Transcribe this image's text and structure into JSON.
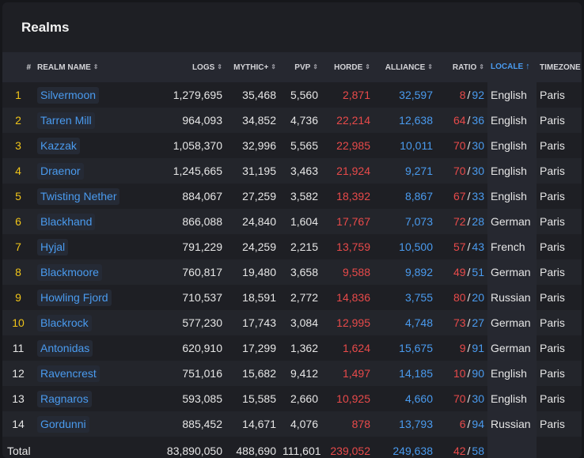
{
  "title": "Realms",
  "headers": {
    "rank": "#",
    "realm": "REALM NAME",
    "logs": "LOGS",
    "mythic": "MYTHIC+",
    "pvp": "PVP",
    "horde": "HORDE",
    "alliance": "ALLIANCE",
    "ratio": "RATIO",
    "locale": "LOCALE",
    "timezone": "TIMEZONE"
  },
  "colors": {
    "gold_rank": "#f0c419",
    "horde": "#e84a4a",
    "alliance": "#4a9bef",
    "active_sort": "#4a9bef"
  },
  "rows": [
    {
      "rank": "1",
      "name": "Silvermoon",
      "logs": "1,279,695",
      "mythic": "35,468",
      "pvp": "5,560",
      "horde": "2,871",
      "alliance": "32,597",
      "ratio_h": "8",
      "ratio_a": "92",
      "locale": "English",
      "timezone": "Paris",
      "gold": true
    },
    {
      "rank": "2",
      "name": "Tarren Mill",
      "logs": "964,093",
      "mythic": "34,852",
      "pvp": "4,736",
      "horde": "22,214",
      "alliance": "12,638",
      "ratio_h": "64",
      "ratio_a": "36",
      "locale": "English",
      "timezone": "Paris",
      "gold": true
    },
    {
      "rank": "3",
      "name": "Kazzak",
      "logs": "1,058,370",
      "mythic": "32,996",
      "pvp": "5,565",
      "horde": "22,985",
      "alliance": "10,011",
      "ratio_h": "70",
      "ratio_a": "30",
      "locale": "English",
      "timezone": "Paris",
      "gold": true
    },
    {
      "rank": "4",
      "name": "Draenor",
      "logs": "1,245,665",
      "mythic": "31,195",
      "pvp": "3,463",
      "horde": "21,924",
      "alliance": "9,271",
      "ratio_h": "70",
      "ratio_a": "30",
      "locale": "English",
      "timezone": "Paris",
      "gold": true
    },
    {
      "rank": "5",
      "name": "Twisting Nether",
      "logs": "884,067",
      "mythic": "27,259",
      "pvp": "3,582",
      "horde": "18,392",
      "alliance": "8,867",
      "ratio_h": "67",
      "ratio_a": "33",
      "locale": "English",
      "timezone": "Paris",
      "gold": true
    },
    {
      "rank": "6",
      "name": "Blackhand",
      "logs": "866,088",
      "mythic": "24,840",
      "pvp": "1,604",
      "horde": "17,767",
      "alliance": "7,073",
      "ratio_h": "72",
      "ratio_a": "28",
      "locale": "German",
      "timezone": "Paris",
      "gold": true
    },
    {
      "rank": "7",
      "name": "Hyjal",
      "logs": "791,229",
      "mythic": "24,259",
      "pvp": "2,215",
      "horde": "13,759",
      "alliance": "10,500",
      "ratio_h": "57",
      "ratio_a": "43",
      "locale": "French",
      "timezone": "Paris",
      "gold": true
    },
    {
      "rank": "8",
      "name": "Blackmoore",
      "logs": "760,817",
      "mythic": "19,480",
      "pvp": "3,658",
      "horde": "9,588",
      "alliance": "9,892",
      "ratio_h": "49",
      "ratio_a": "51",
      "locale": "German",
      "timezone": "Paris",
      "gold": true
    },
    {
      "rank": "9",
      "name": "Howling Fjord",
      "logs": "710,537",
      "mythic": "18,591",
      "pvp": "2,772",
      "horde": "14,836",
      "alliance": "3,755",
      "ratio_h": "80",
      "ratio_a": "20",
      "locale": "Russian",
      "timezone": "Paris",
      "gold": true
    },
    {
      "rank": "10",
      "name": "Blackrock",
      "logs": "577,230",
      "mythic": "17,743",
      "pvp": "3,084",
      "horde": "12,995",
      "alliance": "4,748",
      "ratio_h": "73",
      "ratio_a": "27",
      "locale": "German",
      "timezone": "Paris",
      "gold": true
    },
    {
      "rank": "11",
      "name": "Antonidas",
      "logs": "620,910",
      "mythic": "17,299",
      "pvp": "1,362",
      "horde": "1,624",
      "alliance": "15,675",
      "ratio_h": "9",
      "ratio_a": "91",
      "locale": "German",
      "timezone": "Paris",
      "gold": false
    },
    {
      "rank": "12",
      "name": "Ravencrest",
      "logs": "751,016",
      "mythic": "15,682",
      "pvp": "9,412",
      "horde": "1,497",
      "alliance": "14,185",
      "ratio_h": "10",
      "ratio_a": "90",
      "locale": "English",
      "timezone": "Paris",
      "gold": false
    },
    {
      "rank": "13",
      "name": "Ragnaros",
      "logs": "593,085",
      "mythic": "15,585",
      "pvp": "2,660",
      "horde": "10,925",
      "alliance": "4,660",
      "ratio_h": "70",
      "ratio_a": "30",
      "locale": "English",
      "timezone": "Paris",
      "gold": false
    },
    {
      "rank": "14",
      "name": "Gordunni",
      "logs": "885,452",
      "mythic": "14,671",
      "pvp": "4,076",
      "horde": "878",
      "alliance": "13,793",
      "ratio_h": "6",
      "ratio_a": "94",
      "locale": "Russian",
      "timezone": "Paris",
      "gold": false
    }
  ],
  "total": {
    "label": "Total",
    "logs": "83,890,050",
    "mythic": "488,690",
    "pvp": "111,601",
    "horde": "239,052",
    "alliance": "249,638",
    "ratio_h": "42",
    "ratio_a": "58"
  }
}
